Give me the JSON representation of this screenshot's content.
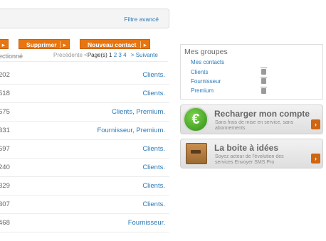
{
  "filter": {
    "advanced_link": "Filtre avancé"
  },
  "actions": {
    "left_btn_arrow": "▸",
    "supprimer": "Supprimer",
    "nouveau_contact": "Nouveau contact",
    "btn_arrow": "▸"
  },
  "selection_label": "ectionné",
  "pagination": {
    "prev": "Précédente <",
    "label": "Page(s) 1",
    "pages": [
      "2",
      "3",
      "4"
    ],
    "next": "> Suivante"
  },
  "rows": [
    {
      "num": "202",
      "groups": "Clients."
    },
    {
      "num": "518",
      "groups": "Clients."
    },
    {
      "num": "575",
      "groups": "Clients, Premium."
    },
    {
      "num": "331",
      "groups": "Fournisseur, Premium."
    },
    {
      "num": "597",
      "groups": "Clients."
    },
    {
      "num": "240",
      "groups": "Clients."
    },
    {
      "num": "329",
      "groups": "Clients."
    },
    {
      "num": "307",
      "groups": "Clients."
    },
    {
      "num": "468",
      "groups": "Fournisseur."
    }
  ],
  "groups_panel": {
    "title": "Mes groupes",
    "items": [
      "Mes contacts",
      "Clients",
      "Fournisseur",
      "Premium"
    ]
  },
  "promo_recharge": {
    "title": "Recharger mon compte",
    "subtitle": "Sans frais de mise en service, sans abonnements",
    "icon": "euro-coin-icon"
  },
  "promo_ideas": {
    "title": "La boite à idées",
    "subtitle": "Soyez acteur de l'évolution des services Envoyer SMS Pro",
    "icon": "idea-box-icon"
  },
  "colors": {
    "accent": "#e8750f",
    "link": "#2a7ab8"
  }
}
